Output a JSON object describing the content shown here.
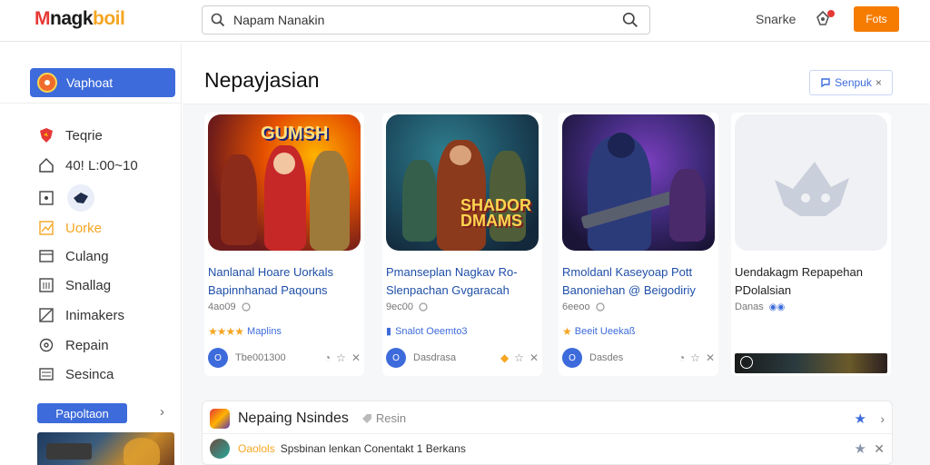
{
  "app": {
    "logo_part1": "M",
    "logo_part2": "nagk",
    "logo_part3": "boil"
  },
  "search": {
    "value": "Napam Nanakin",
    "placeholder": "Napam Nanakin"
  },
  "topbar": {
    "link_label": "Snarke",
    "button_label": "Fots"
  },
  "sidebar": {
    "primary_label": "Vaphoat",
    "items": [
      {
        "label": "Teqrie",
        "icon": "shield-icon"
      },
      {
        "label": "40! L:00~10",
        "icon": "home-icon"
      },
      {
        "label": "",
        "icon": "toggle-icon"
      },
      {
        "label": "Uorke",
        "icon": "chart-icon"
      },
      {
        "label": "Culang",
        "icon": "window-icon"
      },
      {
        "label": "Snallag",
        "icon": "grid-icon"
      },
      {
        "label": "Inimakers",
        "icon": "image-icon"
      },
      {
        "label": "Repain",
        "icon": "gear-icon"
      },
      {
        "label": "Sesinca",
        "icon": "list-icon"
      }
    ],
    "bottom_button": "Papoltaon",
    "chevron": "›"
  },
  "main": {
    "title": "Nepayjasian",
    "header_button": "Senpuk",
    "header_close": "×"
  },
  "cards": [
    {
      "line1": "Nanlanal Hoare Uorkals",
      "line2": "Bapinnhanad Paqouns",
      "meta": "4ao09",
      "rating_stars": "★★★★",
      "rating_text": "Maplins",
      "footer": "Tbe001300"
    },
    {
      "line1": "Pmanseplan Nagkav Ro-",
      "line2": "Slenpachan Gvgaracah",
      "meta": "9ec00",
      "rating_stars": "",
      "rating_text": "Snalot Oeemto3",
      "footer": "Dasdrasa"
    },
    {
      "line1": "Rmoldanl Kaseyoap Pott",
      "line2": "Banoniehan @ Beigodiriy",
      "meta": "6eeoo",
      "rating_stars": "★",
      "rating_text": "Beeit Ueekaß",
      "footer": "Dasdes"
    },
    {
      "line1": "Uendakagm Repapehan",
      "line2": "PDolalsian",
      "meta": "Danas",
      "rating_stars": "",
      "rating_text": "",
      "footer": ""
    }
  ],
  "list": {
    "row1_title": "Nepaing Nsindes",
    "row1_tag": "Resin",
    "row2_sub1": "Oaolols",
    "row2_sub2": "Spsbinan lenkan Conentakt 1 Berkans"
  },
  "colors": {
    "accent_blue": "#3d6bdb",
    "accent_orange": "#f57c00",
    "highlight_yellow": "#f5a623"
  }
}
